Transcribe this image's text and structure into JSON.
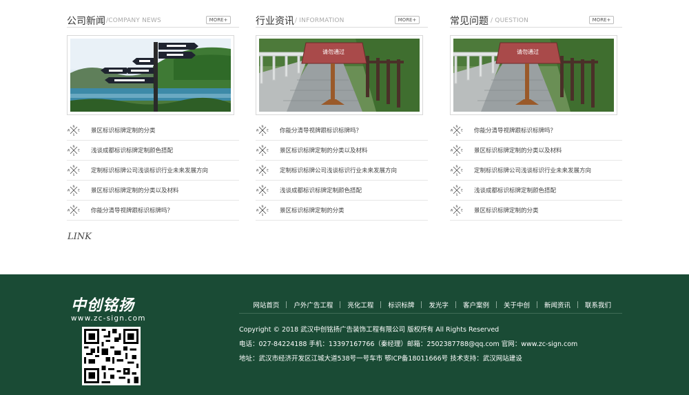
{
  "columns": [
    {
      "title": "公司新闻",
      "subtitle": "/COMPANY NEWS",
      "more_label": "MORE+",
      "image": "signpost-photo",
      "items": [
        "景区标识标牌定制的分类",
        "浅谈成都标识标牌定制颜色搭配",
        "定制标识标牌公司浅谈标识行业未来发展方向",
        "景区标识标牌定制的分类以及材料",
        "你能分清导视牌跟标识标牌吗？"
      ]
    },
    {
      "title": "行业资讯",
      "subtitle": "/ INFORMATION",
      "more_label": "MORE+",
      "image": "warning-sign-photo",
      "sign_text": "请勿通过",
      "items": [
        "你能分清导视牌跟标识标牌吗？",
        "景区标识标牌定制的分类以及材料",
        "定制标识标牌公司浅谈标识行业未来发展方向",
        "浅谈成都标识标牌定制颜色搭配",
        "景区标识标牌定制的分类"
      ]
    },
    {
      "title": "常见问题",
      "subtitle": "/ QUESTION",
      "more_label": "MORE+",
      "image": "warning-sign-photo",
      "sign_text": "请勿通过",
      "items": [
        "你能分清导视牌跟标识标牌吗？",
        "景区标识标牌定制的分类以及材料",
        "定制标识标牌公司浅谈标识行业未来发展方向",
        "浅谈成都标识标牌定制颜色搭配",
        "景区标识标牌定制的分类"
      ]
    }
  ],
  "link_label": "LINK",
  "footer": {
    "logo_text": "中创铭扬",
    "logo_url": "www.zc-sign.com",
    "nav": [
      "网站首页",
      "户外广告工程",
      "亮化工程",
      "标识标牌",
      "发光字",
      "客户案例",
      "关于中创",
      "新闻资讯",
      "联系我们"
    ],
    "copyright": "Copyright © 2018 武汉中创铭扬广告装饰工程有限公司 版权所有 All Rights Reserved",
    "contact": "电话：027-84224188 手机：13397167766（秦经理）邮箱：2502387788@qq.com 官网：www.zc-sign.com",
    "address": "地址：武汉市经济开发区江城大道538号一号车市  鄂ICP备18011666号 技术支持：武汉网站建设"
  },
  "colors": {
    "footer_bg": "#1a4b35",
    "text": "#444444",
    "border": "#e6e6e6"
  }
}
